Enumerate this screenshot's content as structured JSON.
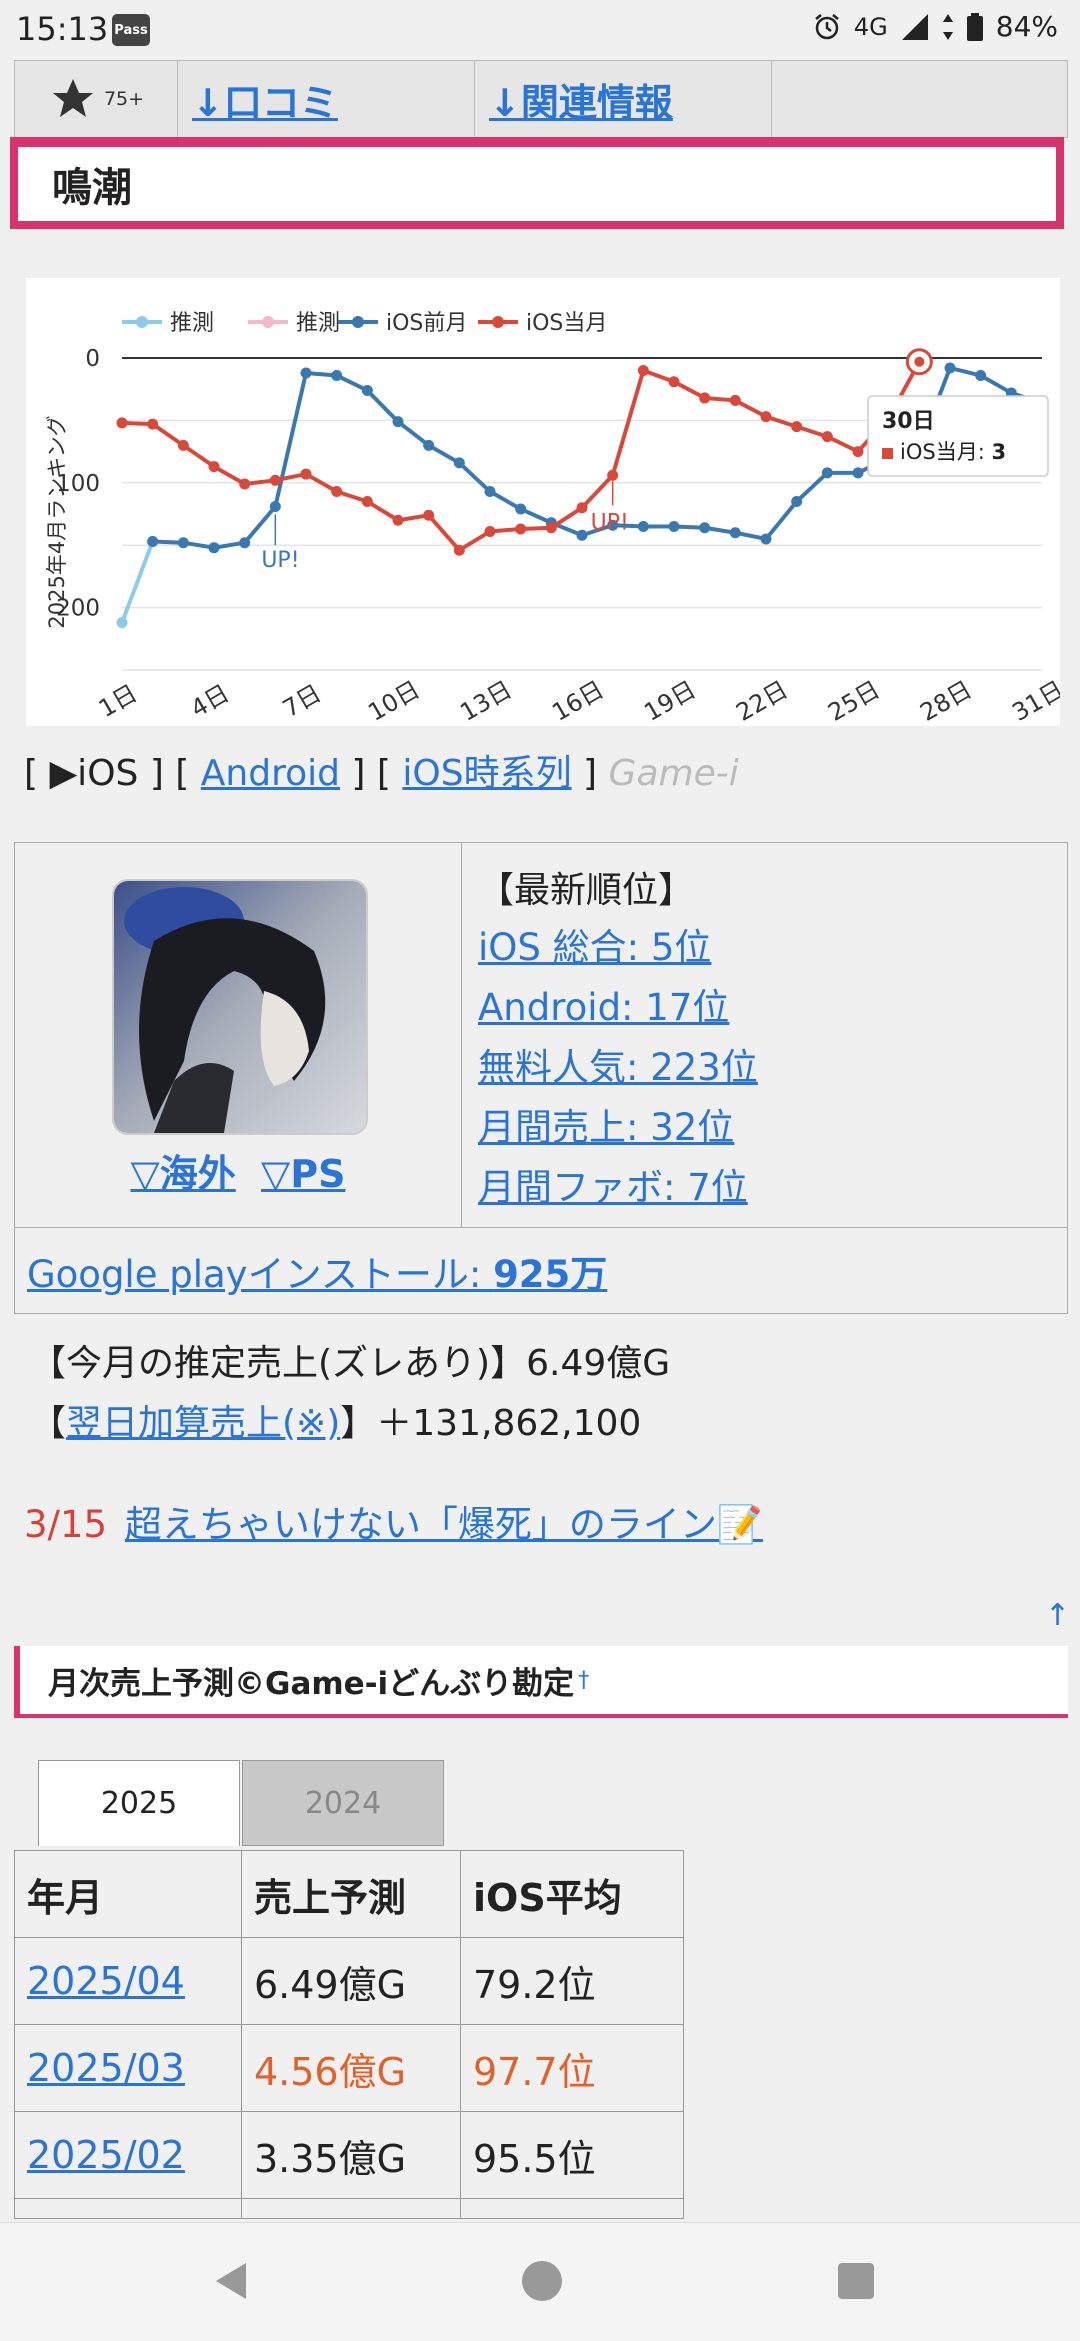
{
  "status": {
    "time": "15:13",
    "pass": "Pass",
    "network": "4G",
    "battery": "84%"
  },
  "nav": {
    "badge": "75+",
    "reviews": "↓口コミ",
    "related": "↓関連情報"
  },
  "title": "鳴潮",
  "chart_data": {
    "type": "line",
    "ylabel": "2025年4月ランキング",
    "ylim": [
      0,
      250
    ],
    "y_reversed": true,
    "yticks": [
      "0",
      "100",
      "200"
    ],
    "categories": [
      "1日",
      "2日",
      "3日",
      "4日",
      "5日",
      "6日",
      "7日",
      "8日",
      "9日",
      "10日",
      "11日",
      "12日",
      "13日",
      "14日",
      "15日",
      "16日",
      "17日",
      "18日",
      "19日",
      "20日",
      "21日",
      "22日",
      "23日",
      "24日",
      "25日",
      "26日",
      "27日",
      "28日",
      "29日",
      "30日",
      "31日"
    ],
    "xticks": [
      "1日",
      "4日",
      "7日",
      "10日",
      "13日",
      "16日",
      "19日",
      "22日",
      "25日",
      "28日",
      "31日"
    ],
    "series": [
      {
        "name": "推測",
        "color": "#8ecbe9",
        "points": [
          [
            1,
            212
          ],
          [
            2,
            147
          ]
        ]
      },
      {
        "name": "推測",
        "color": "#f4b8c8",
        "points": []
      },
      {
        "name": "iOS前月",
        "color": "#3b78b0",
        "points": [
          [
            2,
            147
          ],
          [
            3,
            148
          ],
          [
            4,
            152
          ],
          [
            5,
            148
          ],
          [
            6,
            119
          ],
          [
            7,
            12
          ],
          [
            8,
            14
          ],
          [
            9,
            26
          ],
          [
            10,
            51
          ],
          [
            11,
            70
          ],
          [
            12,
            84
          ],
          [
            13,
            107
          ],
          [
            14,
            121
          ],
          [
            15,
            132
          ],
          [
            16,
            142
          ],
          [
            17,
            134
          ],
          [
            18,
            135
          ],
          [
            19,
            135
          ],
          [
            20,
            136
          ],
          [
            21,
            140
          ],
          [
            22,
            145
          ],
          [
            23,
            115
          ],
          [
            24,
            92
          ],
          [
            25,
            92
          ],
          [
            26,
            80
          ],
          [
            27,
            72
          ],
          [
            28,
            8
          ],
          [
            29,
            14
          ],
          [
            30,
            28
          ],
          [
            31,
            36
          ]
        ]
      },
      {
        "name": "iOS当月",
        "color": "#d8493c",
        "points": [
          [
            1,
            52
          ],
          [
            2,
            53
          ],
          [
            3,
            70
          ],
          [
            4,
            87
          ],
          [
            5,
            101
          ],
          [
            6,
            98
          ],
          [
            7,
            93
          ],
          [
            8,
            107
          ],
          [
            9,
            115
          ],
          [
            10,
            130
          ],
          [
            11,
            126
          ],
          [
            12,
            154
          ],
          [
            13,
            139
          ],
          [
            14,
            137
          ],
          [
            15,
            136
          ],
          [
            16,
            120
          ],
          [
            17,
            94
          ],
          [
            18,
            10
          ],
          [
            19,
            19
          ],
          [
            20,
            32
          ],
          [
            21,
            34
          ],
          [
            22,
            47
          ],
          [
            23,
            55
          ],
          [
            24,
            63
          ],
          [
            25,
            75
          ],
          [
            26,
            48
          ],
          [
            27,
            3
          ]
        ]
      }
    ],
    "annotations": [
      {
        "text": "UP!",
        "series": "iOS前月"
      },
      {
        "text": "UP!",
        "series": "iOS当月"
      }
    ],
    "tooltip": {
      "title": "30日",
      "series": "iOS当月",
      "label": "iOS当月: ",
      "value": "3"
    }
  },
  "platform": {
    "ios": "▶iOS",
    "android": "Android",
    "timeseries": "iOS時系列",
    "brand": "Game-i"
  },
  "info": {
    "region_overseas": "▽海外",
    "region_ps": "▽PS",
    "rank_head": "【最新順位】",
    "ranks": [
      "iOS 総合: 5位",
      "Android: 17位",
      "無料人気: 223位",
      "月間売上: 32位",
      "月間ファボ: 7位"
    ],
    "install_label": "Google playインストール: ",
    "install_value": "925万"
  },
  "sales": {
    "est_label": "【今月の推定売上(ズレあり)】6.49億G",
    "next_open": "【",
    "next_link": "翌日加算売上(※)",
    "next_rest": "】＋131,862,100"
  },
  "alert": {
    "date": "3/15",
    "text": "超えちゃいけない「爆死」のライン📝"
  },
  "monthly": {
    "heading": "月次売上予測©Game-iどんぶり勘定",
    "dagger": "†",
    "tabs": [
      "2025",
      "2024"
    ],
    "headers": [
      "年月",
      "売上予測",
      "iOS平均"
    ],
    "rows": [
      {
        "month": "2025/04",
        "sales": "6.49億G",
        "ios": "79.2位",
        "highlight": false
      },
      {
        "month": "2025/03",
        "sales": "4.56億G",
        "ios": "97.7位",
        "highlight": true
      },
      {
        "month": "2025/02",
        "sales": "3.35億G",
        "ios": "95.5位",
        "highlight": false
      }
    ]
  },
  "top_link": "↑"
}
